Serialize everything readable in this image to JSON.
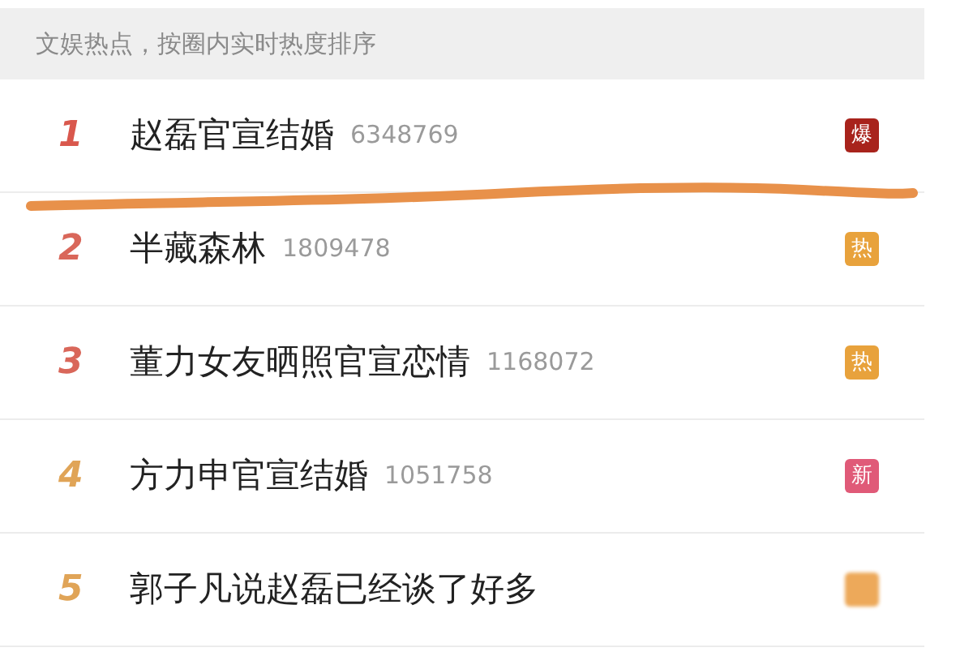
{
  "header": {
    "text": "文娱热点，按圈内实时热度排序"
  },
  "rows": [
    {
      "rank": "1",
      "color": "#d9584d",
      "title": "赵磊官宣结婚",
      "count": "6348769",
      "badge": {
        "label": "爆",
        "color": "#a8231c",
        "blurred": false
      }
    },
    {
      "rank": "2",
      "color": "#d9675a",
      "title": "半藏森林",
      "count": "1809478",
      "badge": {
        "label": "热",
        "color": "#e8a23c",
        "blurred": false
      }
    },
    {
      "rank": "3",
      "color": "#d9675a",
      "title": "董力女友晒照官宣恋情",
      "count": "1168072",
      "badge": {
        "label": "热",
        "color": "#e8a23c",
        "blurred": false
      }
    },
    {
      "rank": "4",
      "color": "#e0a457",
      "title": "方力申官宣结婚",
      "count": "1051758",
      "badge": {
        "label": "新",
        "color": "#e05a78",
        "blurred": false
      }
    },
    {
      "rank": "5",
      "color": "#e0a457",
      "title": "郭子凡说赵磊已经谈了好多",
      "badge": {
        "color": "#eda95a",
        "blurred": true
      }
    }
  ]
}
